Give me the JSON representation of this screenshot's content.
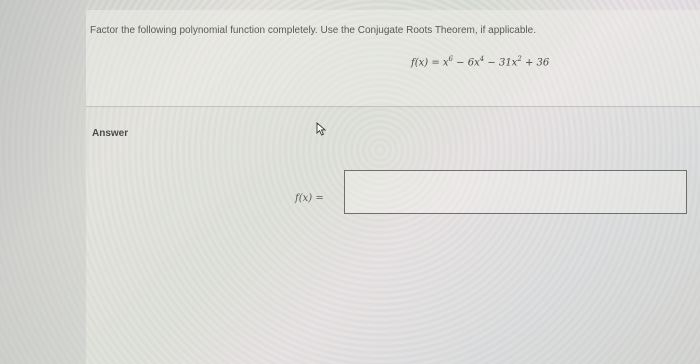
{
  "question": {
    "instruction": "Factor the following polynomial function completely. Use the Conjugate Roots Theorem, if applicable.",
    "function_parts": [
      "f(x) = x",
      "6",
      " − 6x",
      "4",
      " − 31x",
      "2",
      " + 36"
    ]
  },
  "answer": {
    "section_label": "Answer",
    "input_prefix": "f(x) =",
    "input_value": ""
  },
  "icons": {
    "cursor": "mouse-pointer-icon"
  }
}
